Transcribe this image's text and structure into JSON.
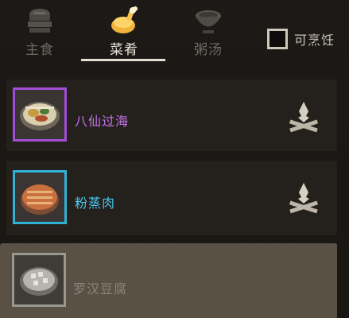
{
  "tabs": [
    {
      "label": "主食",
      "icon": "steamer-bun-icon",
      "active": false
    },
    {
      "label": "菜肴",
      "icon": "roast-chicken-icon",
      "active": true
    },
    {
      "label": "粥汤",
      "icon": "soup-bowl-icon",
      "active": false
    }
  ],
  "filter": {
    "label": "可烹饪",
    "checked": false
  },
  "dishes": [
    {
      "name": "八仙过海",
      "rarity_color": "#a34cd6",
      "icon": "seafood-platter-icon",
      "cook_icon": "campfire-icon"
    },
    {
      "name": "粉蒸肉",
      "rarity_color": "#2fb2d6",
      "icon": "steamed-pork-icon",
      "cook_icon": "campfire-icon"
    },
    {
      "name": "罗汉豆腐",
      "rarity_color": "#9a9690",
      "icon": "tofu-plate-icon",
      "selected": true
    }
  ],
  "colors": {
    "accent": "#e6dfcf",
    "background": "#1c1916",
    "selected_row": "#5a5145"
  }
}
